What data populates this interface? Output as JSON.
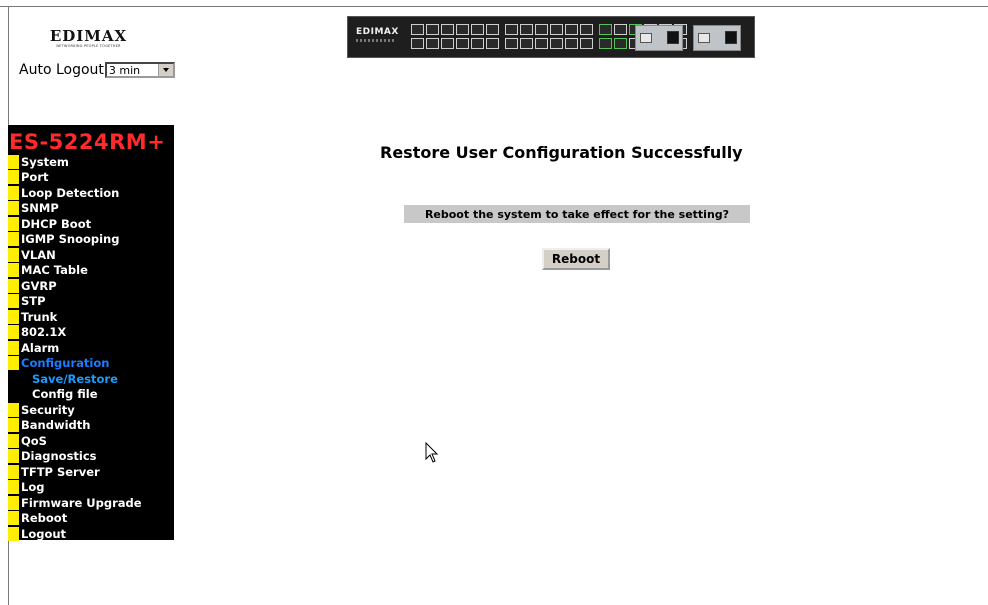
{
  "brand": {
    "logo_text": "EDIMAX",
    "logo_tagline": "NETWORKING PEOPLE TOGETHER"
  },
  "auto_logout": {
    "label": "Auto Logout",
    "selected": "3 min"
  },
  "switch_image": {
    "brand": "EDIMAX"
  },
  "sidebar": {
    "title": "ES-5224RM+",
    "items": [
      {
        "label": "System"
      },
      {
        "label": "Port"
      },
      {
        "label": "Loop Detection"
      },
      {
        "label": "SNMP"
      },
      {
        "label": "DHCP Boot"
      },
      {
        "label": "IGMP Snooping"
      },
      {
        "label": "VLAN"
      },
      {
        "label": "MAC Table"
      },
      {
        "label": "GVRP"
      },
      {
        "label": "STP"
      },
      {
        "label": "Trunk"
      },
      {
        "label": "802.1X"
      },
      {
        "label": "Alarm"
      },
      {
        "label": "Configuration"
      },
      {
        "label": "Save/Restore"
      },
      {
        "label": "Config file"
      },
      {
        "label": "Security"
      },
      {
        "label": "Bandwidth"
      },
      {
        "label": "QoS"
      },
      {
        "label": "Diagnostics"
      },
      {
        "label": "TFTP Server"
      },
      {
        "label": "Log"
      },
      {
        "label": "Firmware Upgrade"
      },
      {
        "label": "Reboot"
      },
      {
        "label": "Logout"
      }
    ]
  },
  "main": {
    "title": "Restore User Configuration Successfully",
    "prompt": "Reboot the system to take effect for the setting?",
    "reboot_button": "Reboot"
  },
  "colors": {
    "sidebar_bg": "#000000",
    "sidebar_title": "#ff2a2a",
    "menu_bullet": "#ffee00",
    "menu_active": "#1a7cff",
    "prompt_bar": "#c8c8c8"
  }
}
